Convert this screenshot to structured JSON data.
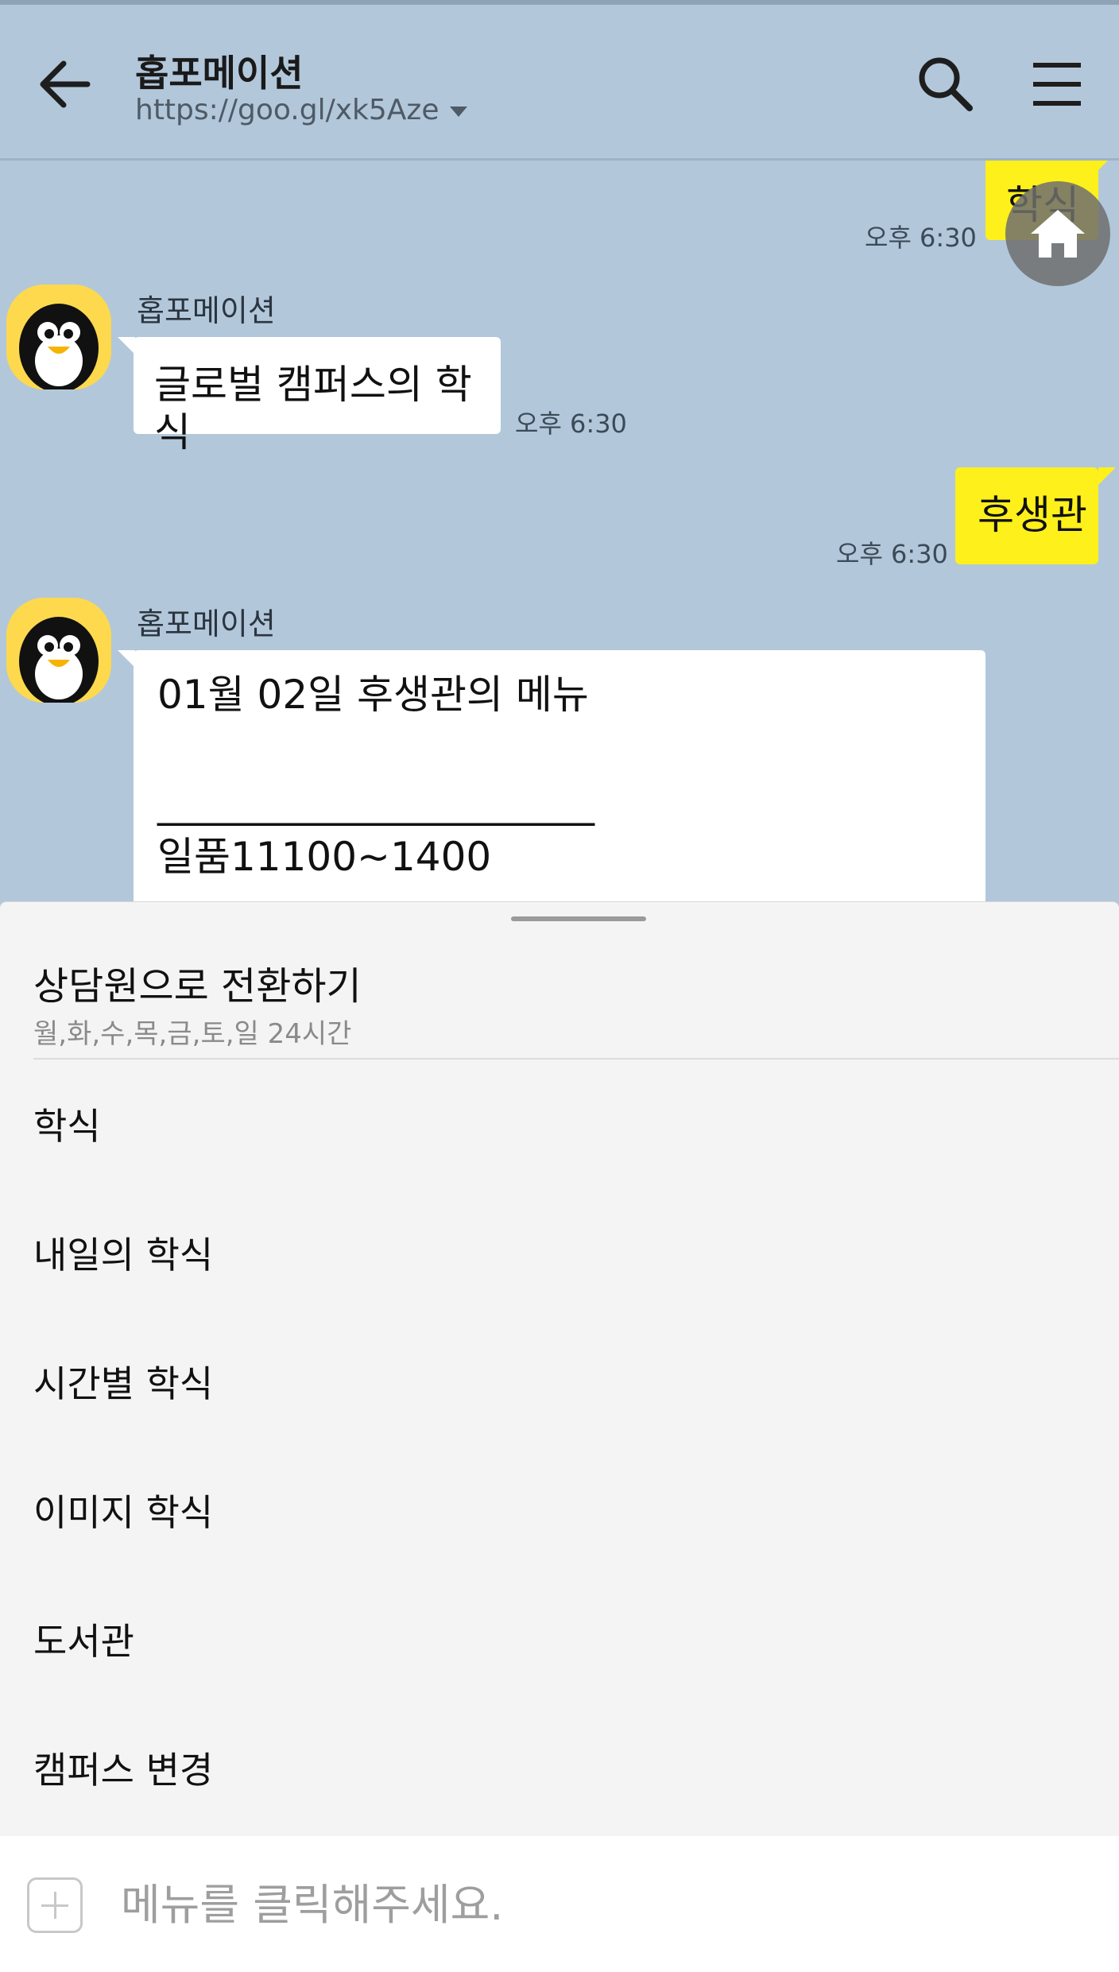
{
  "header": {
    "title": "홉포메이션",
    "url": "https://goo.gl/xk5Aze"
  },
  "chat": {
    "messages": [
      {
        "from": "me",
        "text": "학식",
        "time": "오후 6:30"
      },
      {
        "from": "bot",
        "sender": "홉포메이션",
        "text": "글로벌 캠퍼스의 학식",
        "time": "오후 6:30"
      },
      {
        "from": "me",
        "text": "후생관",
        "time": "오후 6:30"
      },
      {
        "from": "bot",
        "sender": "홉포메이션",
        "lines": [
          "01월 02일 후생관의 메뉴",
          "",
          "______________________",
          "일품11100~1400"
        ]
      }
    ]
  },
  "sheet": {
    "title": "상담원으로 전환하기",
    "subtitle": "월,화,수,목,금,토,일 24시간",
    "items": [
      {
        "label": "학식"
      },
      {
        "label": "내일의 학식"
      },
      {
        "label": "시간별 학식"
      },
      {
        "label": "이미지 학식"
      },
      {
        "label": "도서관"
      },
      {
        "label": "캠퍼스 변경"
      }
    ]
  },
  "input": {
    "placeholder": "메뉴를 클릭해주세요."
  },
  "colors": {
    "chat_bg": "#b2c7da",
    "my_bubble": "#fef01b",
    "bot_bubble": "#ffffff",
    "sheet_bg": "#f4f4f4"
  },
  "icons": [
    "back-arrow-icon",
    "search-icon",
    "hamburger-menu-icon",
    "penguin-avatar-icon",
    "home-icon",
    "plus-icon"
  ]
}
